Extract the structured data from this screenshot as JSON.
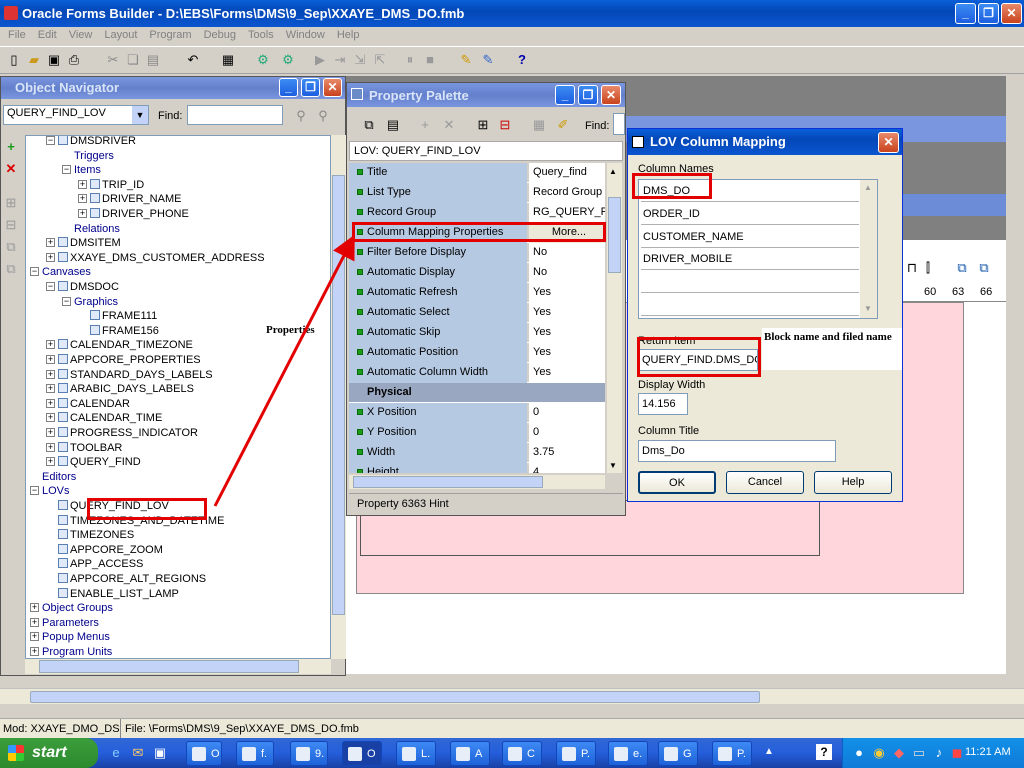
{
  "app_title": "Oracle Forms Builder - D:\\EBS\\Forms\\DMS\\9_Sep\\XXAYE_DMS_DO.fmb",
  "menu": [
    "File",
    "Edit",
    "View",
    "Layout",
    "Program",
    "Debug",
    "Tools",
    "Window",
    "Help"
  ],
  "navigator": {
    "title": "Object Navigator",
    "dropdown_value": "QUERY_FIND_LOV",
    "find_label": "Find:",
    "find_value": "",
    "tree": [
      {
        "label": "DMSDRIVER",
        "type": "item",
        "expand": "-"
      },
      {
        "label": "Triggers",
        "type": "lbl"
      },
      {
        "label": "Items",
        "type": "lbl",
        "expand": "-"
      },
      {
        "label": "TRIP_ID",
        "type": "item",
        "expand": "+"
      },
      {
        "label": "DRIVER_NAME",
        "type": "item",
        "expand": "+"
      },
      {
        "label": "DRIVER_PHONE",
        "type": "item",
        "expand": "+"
      },
      {
        "label": "Relations",
        "type": "lbl"
      },
      {
        "label": "DMSITEM",
        "type": "item",
        "expand": "+"
      },
      {
        "label": "XXAYE_DMS_CUSTOMER_ADDRESS",
        "type": "item",
        "expand": "+"
      },
      {
        "label": "Canvases",
        "type": "lbl",
        "expand": "-"
      },
      {
        "label": "DMSDOC",
        "type": "item",
        "expand": "-"
      },
      {
        "label": "Graphics",
        "type": "lbl",
        "expand": "-"
      },
      {
        "label": "FRAME111",
        "type": "item"
      },
      {
        "label": "FRAME156",
        "type": "item"
      },
      {
        "label": "CALENDAR_TIMEZONE",
        "type": "item",
        "expand": "+"
      },
      {
        "label": "APPCORE_PROPERTIES",
        "type": "item",
        "expand": "+"
      },
      {
        "label": "STANDARD_DAYS_LABELS",
        "type": "item",
        "expand": "+"
      },
      {
        "label": "ARABIC_DAYS_LABELS",
        "type": "item",
        "expand": "+"
      },
      {
        "label": "CALENDAR",
        "type": "item",
        "expand": "+"
      },
      {
        "label": "CALENDAR_TIME",
        "type": "item",
        "expand": "+"
      },
      {
        "label": "PROGRESS_INDICATOR",
        "type": "item",
        "expand": "+"
      },
      {
        "label": "TOOLBAR",
        "type": "item",
        "expand": "+"
      },
      {
        "label": "QUERY_FIND",
        "type": "item",
        "expand": "+"
      },
      {
        "label": "Editors",
        "type": "lbl"
      },
      {
        "label": "LOVs",
        "type": "lbl",
        "expand": "-"
      },
      {
        "label": "QUERY_FIND_LOV",
        "type": "item"
      },
      {
        "label": "TIMEZONES_AND_DATETIME",
        "type": "item"
      },
      {
        "label": "TIMEZONES",
        "type": "item"
      },
      {
        "label": "APPCORE_ZOOM",
        "type": "item"
      },
      {
        "label": "APP_ACCESS",
        "type": "item"
      },
      {
        "label": "APPCORE_ALT_REGIONS",
        "type": "item"
      },
      {
        "label": "ENABLE_LIST_LAMP",
        "type": "item"
      },
      {
        "label": "Object Groups",
        "type": "lbl",
        "expand": "+"
      },
      {
        "label": "Parameters",
        "type": "lbl",
        "expand": "+"
      },
      {
        "label": "Popup Menus",
        "type": "lbl",
        "expand": "+"
      },
      {
        "label": "Program Units",
        "type": "lbl",
        "expand": "+"
      }
    ]
  },
  "palette": {
    "title": "Property Palette",
    "find_label": "Find:",
    "header": "LOV: QUERY_FIND_LOV",
    "section_physical": "Physical",
    "hint": "Property 6363 Hint",
    "rows": [
      {
        "name": "Title",
        "value": "Query_find"
      },
      {
        "name": "List Type",
        "value": "Record Group"
      },
      {
        "name": "Record Group",
        "value": "RG_QUERY_FIND"
      },
      {
        "name": "Column Mapping Properties",
        "value": "More..."
      },
      {
        "name": "Filter Before Display",
        "value": "No"
      },
      {
        "name": "Automatic Display",
        "value": "No"
      },
      {
        "name": "Automatic Refresh",
        "value": "Yes"
      },
      {
        "name": "Automatic Select",
        "value": "Yes"
      },
      {
        "name": "Automatic Skip",
        "value": "Yes"
      },
      {
        "name": "Automatic Position",
        "value": "Yes"
      },
      {
        "name": "Automatic Column Width",
        "value": "Yes"
      }
    ],
    "physical_rows": [
      {
        "name": "X Position",
        "value": "0"
      },
      {
        "name": "Y Position",
        "value": "0"
      },
      {
        "name": "Width",
        "value": "3.75"
      },
      {
        "name": "Height",
        "value": "4"
      }
    ]
  },
  "dialog": {
    "title": "LOV Column Mapping",
    "column_names_label": "Column Names",
    "columns": [
      "DMS_DO",
      "ORDER_ID",
      "CUSTOMER_NAME",
      "DRIVER_MOBILE",
      "",
      ""
    ],
    "return_item_label": "Return Item",
    "return_item_value": "QUERY_FIND.DMS_DO",
    "display_width_label": "Display Width",
    "display_width_value": "14.156",
    "column_title_label": "Column Title",
    "column_title_value": "Dms_Do",
    "ok": "OK",
    "cancel": "Cancel",
    "help": "Help"
  },
  "annotations": {
    "properties": "Properties",
    "block_name": "Block name and filed name"
  },
  "ruler": [
    "60",
    "63",
    "66"
  ],
  "status_bar": {
    "mod": "Mod: XXAYE_DMO_DS",
    "file": "File: \\Forms\\DMS\\9_Sep\\XXAYE_DMS_DO.fmb"
  },
  "taskbar": {
    "start": "start",
    "items": [
      "O",
      "f.",
      "9.",
      "O",
      "L.",
      "A",
      "C",
      "P.",
      "e.",
      "G",
      "P."
    ],
    "clock": "11:21 AM"
  }
}
